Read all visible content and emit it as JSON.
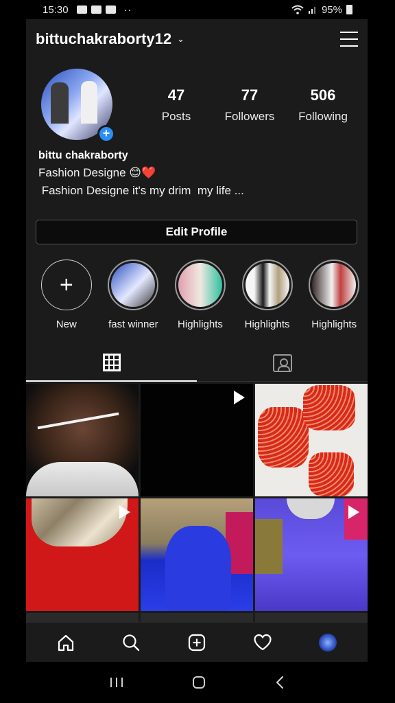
{
  "status_bar": {
    "time": "15:30",
    "dots": "··",
    "battery": "95%"
  },
  "header": {
    "username": "bittuchakraborty12"
  },
  "profile": {
    "stats": [
      {
        "value": "47",
        "label": "Posts"
      },
      {
        "value": "77",
        "label": "Followers"
      },
      {
        "value": "506",
        "label": "Following"
      }
    ],
    "name": "bittu chakraborty",
    "bio_line_1": "Fashion Designe 😊❤️",
    "bio_line_2": " Fashion Designe it's my drim  my life ...",
    "edit_button": "Edit Profile"
  },
  "highlights": [
    {
      "label": "New",
      "kind": "new"
    },
    {
      "label": "fast winner",
      "colors": [
        "#2b4fbf",
        "#e4e8ff",
        "#3a3a3a"
      ]
    },
    {
      "label": "Highlights",
      "colors": [
        "#e0a0b0",
        "#f0e8e0",
        "#30c0a0"
      ]
    },
    {
      "label": "Highlights",
      "colors": [
        "#f6f6f6",
        "#1a1a1a",
        "#b0a080"
      ]
    },
    {
      "label": "Highlights",
      "colors": [
        "#3a2a2a",
        "#f0f0f0",
        "#c04040"
      ]
    }
  ],
  "tabs": {
    "grid": "grid-icon",
    "tagged": "tagged-icon"
  },
  "bottom_nav": [
    "home-icon",
    "search-icon",
    "new-post-icon",
    "activity-heart-icon",
    "profile-avatar"
  ],
  "colors": {
    "accent": "#2b8ef5",
    "background": "#1b1b1b"
  }
}
